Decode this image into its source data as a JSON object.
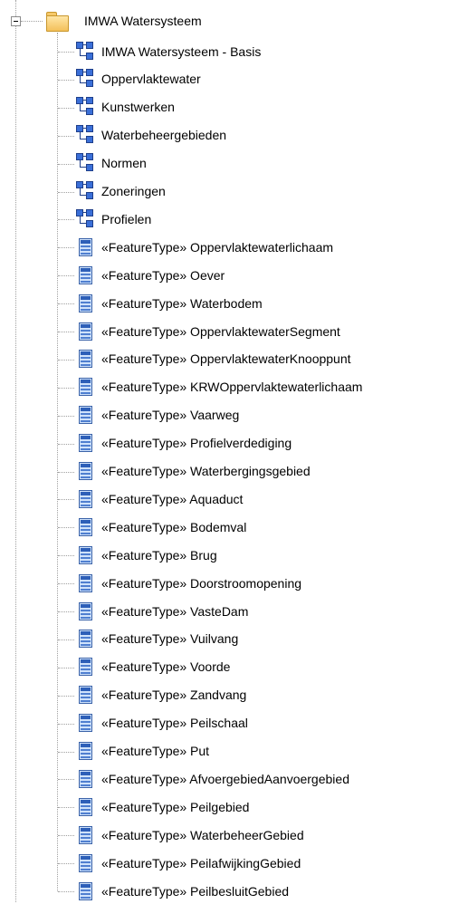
{
  "tree": {
    "root": {
      "label": "IMWA Watersysteem",
      "icon": "folder-icon",
      "expanded": true
    },
    "children": [
      {
        "label": "IMWA Watersysteem - Basis",
        "icon": "package-icon"
      },
      {
        "label": "Oppervlaktewater",
        "icon": "package-icon"
      },
      {
        "label": "Kunstwerken",
        "icon": "package-icon"
      },
      {
        "label": "Waterbeheergebieden",
        "icon": "package-icon"
      },
      {
        "label": "Normen",
        "icon": "package-icon"
      },
      {
        "label": "Zoneringen",
        "icon": "package-icon"
      },
      {
        "label": "Profielen",
        "icon": "package-icon"
      },
      {
        "label": "«FeatureType» Oppervlaktewaterlichaam",
        "icon": "featuretype-icon"
      },
      {
        "label": "«FeatureType» Oever",
        "icon": "featuretype-icon"
      },
      {
        "label": "«FeatureType» Waterbodem",
        "icon": "featuretype-icon"
      },
      {
        "label": "«FeatureType» OppervlaktewaterSegment",
        "icon": "featuretype-icon"
      },
      {
        "label": "«FeatureType» OppervlaktewaterKnooppunt",
        "icon": "featuretype-icon"
      },
      {
        "label": "«FeatureType» KRWOppervlaktewaterlichaam",
        "icon": "featuretype-icon"
      },
      {
        "label": "«FeatureType» Vaarweg",
        "icon": "featuretype-icon"
      },
      {
        "label": "«FeatureType» Profielverdediging",
        "icon": "featuretype-icon"
      },
      {
        "label": "«FeatureType» Waterbergingsgebied",
        "icon": "featuretype-icon"
      },
      {
        "label": "«FeatureType» Aquaduct",
        "icon": "featuretype-icon"
      },
      {
        "label": "«FeatureType» Bodemval",
        "icon": "featuretype-icon"
      },
      {
        "label": "«FeatureType» Brug",
        "icon": "featuretype-icon"
      },
      {
        "label": "«FeatureType» Doorstroomopening",
        "icon": "featuretype-icon"
      },
      {
        "label": "«FeatureType» VasteDam",
        "icon": "featuretype-icon"
      },
      {
        "label": "«FeatureType» Vuilvang",
        "icon": "featuretype-icon"
      },
      {
        "label": "«FeatureType» Voorde",
        "icon": "featuretype-icon"
      },
      {
        "label": "«FeatureType» Zandvang",
        "icon": "featuretype-icon"
      },
      {
        "label": "«FeatureType» Peilschaal",
        "icon": "featuretype-icon"
      },
      {
        "label": "«FeatureType» Put",
        "icon": "featuretype-icon"
      },
      {
        "label": "«FeatureType» AfvoergebiedAanvoergebied",
        "icon": "featuretype-icon"
      },
      {
        "label": "«FeatureType» Peilgebied",
        "icon": "featuretype-icon"
      },
      {
        "label": "«FeatureType» WaterbeheerGebied",
        "icon": "featuretype-icon"
      },
      {
        "label": "«FeatureType» PeilafwijkingGebied",
        "icon": "featuretype-icon"
      },
      {
        "label": "«FeatureType» PeilbesluitGebied",
        "icon": "featuretype-icon"
      }
    ]
  }
}
